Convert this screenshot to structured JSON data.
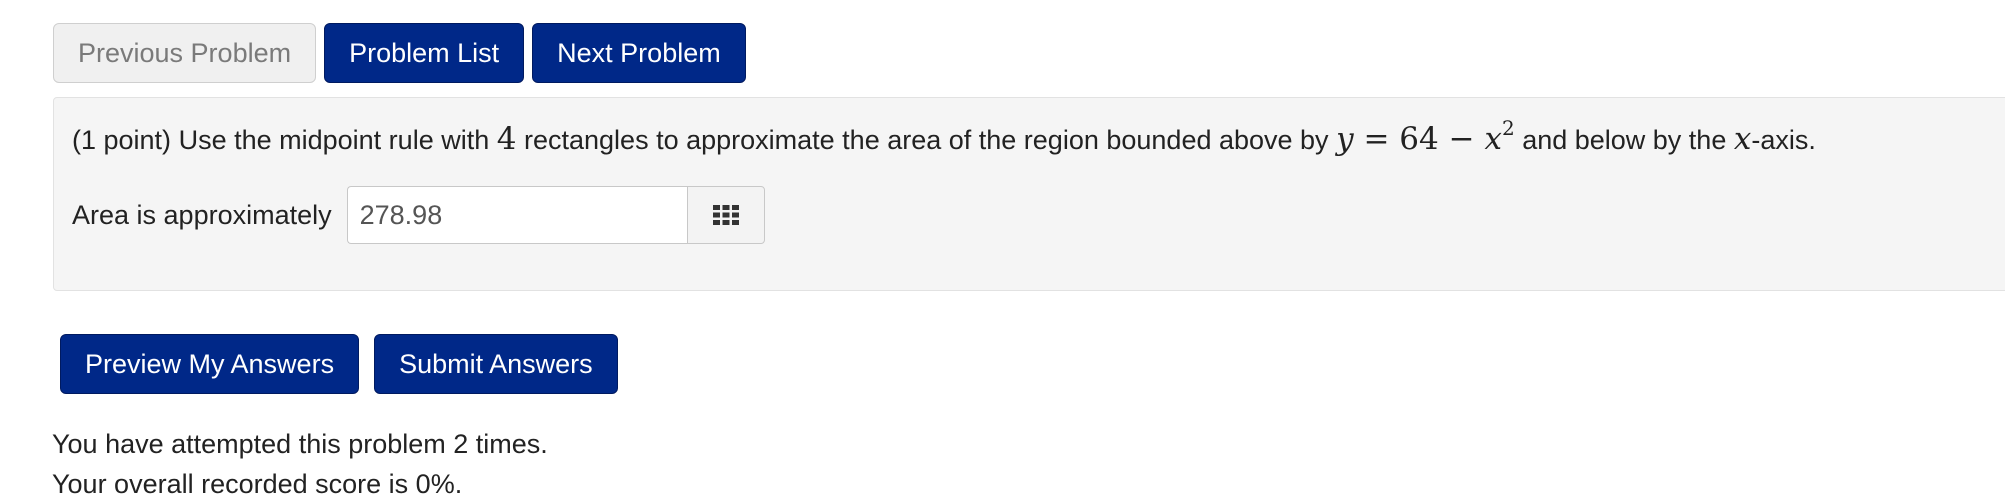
{
  "nav": {
    "previous_label": "Previous Problem",
    "list_label": "Problem List",
    "next_label": "Next Problem"
  },
  "problem": {
    "points": "(1 point)",
    "text_before_n": "Use the midpoint rule with",
    "n_rectangles": "4",
    "text_after_n": "rectangles to approximate the area of the region bounded above by",
    "equation": {
      "lhs": "y",
      "equals": "=",
      "constant": "64",
      "minus": "−",
      "var": "x",
      "exponent": "2"
    },
    "text_after_eq": "and below by the",
    "axis_var": "x",
    "text_end": "-axis."
  },
  "answer": {
    "label": "Area is approximately",
    "value": "278.98",
    "keypad_icon": "keypad-grid-icon"
  },
  "actions": {
    "preview_label": "Preview My Answers",
    "submit_label": "Submit Answers"
  },
  "status": {
    "attempts": "You have attempted this problem 2 times.",
    "score": "Your overall recorded score is 0%."
  },
  "colors": {
    "primary": "#002888",
    "disabled_bg": "#f0f0f0",
    "panel_bg": "#f5f5f5"
  }
}
